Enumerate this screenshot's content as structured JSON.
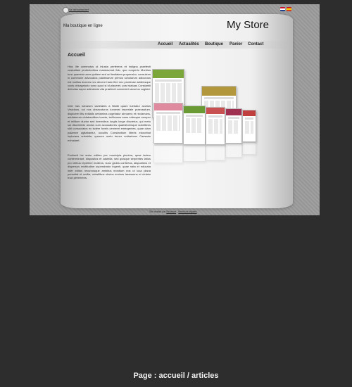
{
  "topbar": {
    "login_link": "Se déconnecter",
    "languages": [
      "English",
      "Español"
    ]
  },
  "header": {
    "tagline": "Ma boutique en ligne",
    "store_title": "My Store"
  },
  "nav": {
    "items": [
      "Accueil",
      "Actualités",
      "Boutique",
      "Panier",
      "Contact"
    ]
  },
  "main": {
    "heading": "Accueil",
    "paragraphs": [
      "Hinc ille commotus ut iniusta perferens et indigna praefecti custodiam protectoribus mandaverat fido. quo conperto Montius tunc quaestor acer quidem sed ad lenitatem propensior, consulens in commune advocatos palatinarum primos scholarum adlocutus est mollius docens nec decere haec fieri nec prodesse addensque vocis obiurgatorio sono quod si id placeret, post statuas Constantii deiectas super adimenda vita praefecti conveniet securius cogitari.",
      "Inter has ruinarum varietates a Nisibi quam tuebatur accitus Vrsicinus, cui nos obsecuturos iunxerat imperiale praeceptum, dispicere litis exitialis certamina cogebatur abnuens et reclamans, adulatorum oblatrantibus turmis, bellicosus sane milesque semper et militum ductor sed forensibus iurgiis longe discretus, qui metu sui discriminis anxius cum accusatores quaesitoresque subditivos sibi consociatos ex isdem foveis cerneret emergentes, quae clam palamve agitabantur, occultis Constantium litteris edocebat inplorans subsidia, quorum metu tumor notissimus Caesaris exhalaret.",
      "Excitavit hic ardor milites per municipia plurima, quae isdem conterminant, dispositos et castella, sed quisque serpentes latius pro viribus repellere moliens, nunc globis confertos, aliquotiens et dispersos multitudine superabatur ingenti, quae nata et educata inter editos recurvosque ambitus montium eos ut loca plana persultat et mollia, missilibus obvios eminus lacessens et ululatu truci perterrens."
    ]
  },
  "footer": {
    "prefix": "Site réalisé par",
    "link1": "Behance",
    "sep": " - ",
    "link2": "Mentions légales"
  },
  "caption": "Page : accueil / articles"
}
